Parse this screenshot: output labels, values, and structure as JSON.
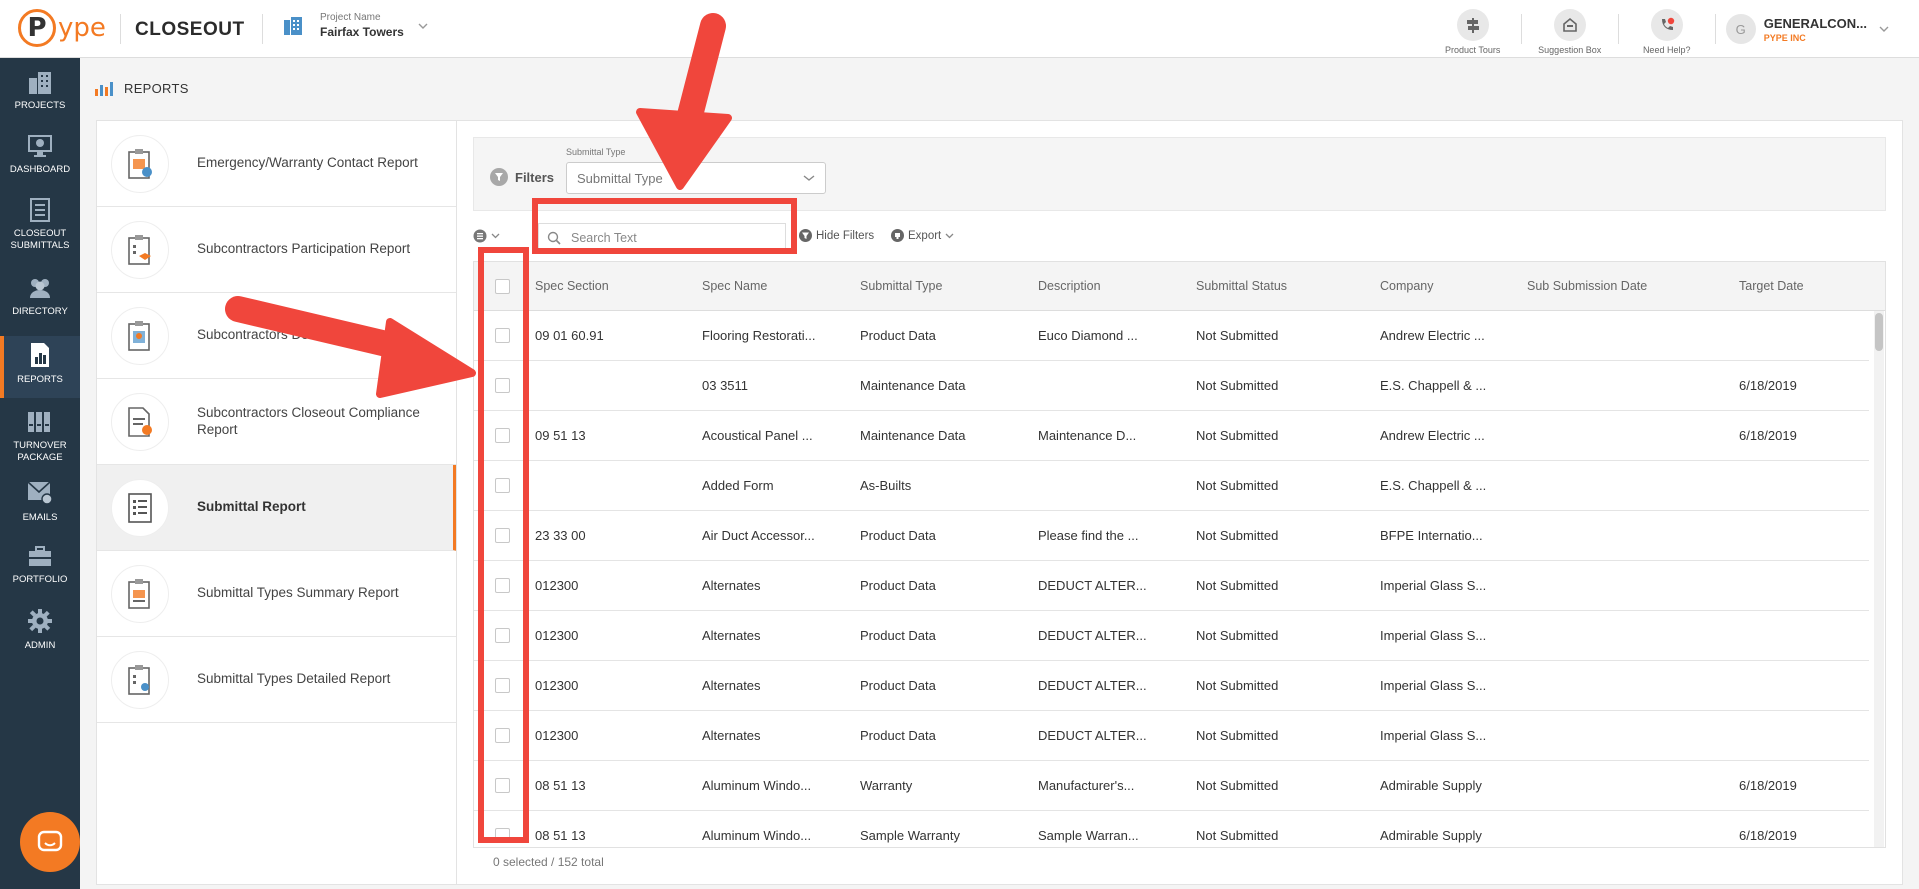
{
  "app": {
    "logo_text": "ype",
    "logo_letter": "P",
    "title": "CLOSEOUT"
  },
  "project": {
    "label": "Project Name",
    "name": "Fairfax Towers"
  },
  "top_actions": [
    {
      "label": "Product Tours",
      "icon": "signpost-icon"
    },
    {
      "label": "Suggestion Box",
      "icon": "suggestion-box-icon"
    },
    {
      "label": "Need Help?",
      "icon": "help-phone-icon"
    }
  ],
  "user": {
    "initial": "G",
    "name": "GENERALCON...",
    "company": "PYPE INC"
  },
  "nav": [
    {
      "label": "PROJECTS",
      "icon": "buildings-icon"
    },
    {
      "label": "DASHBOARD",
      "icon": "monitor-icon"
    },
    {
      "label": "CLOSEOUT SUBMITTALS",
      "icon": "document-list-icon"
    },
    {
      "label": "DIRECTORY",
      "icon": "people-icon"
    },
    {
      "label": "REPORTS",
      "icon": "report-chart-icon"
    },
    {
      "label": "TURNOVER PACKAGE",
      "icon": "binders-icon"
    },
    {
      "label": "EMAILS",
      "icon": "mail-gear-icon"
    },
    {
      "label": "PORTFOLIO",
      "icon": "briefcase-icon"
    },
    {
      "label": "ADMIN",
      "icon": "gear-icon"
    }
  ],
  "page": {
    "title": "REPORTS"
  },
  "reports": [
    "Emergency/Warranty Contact Report",
    "Subcontractors Participation Report",
    "Subcontractors Document Report",
    "Subcontractors Closeout Compliance Report",
    "Submittal Report",
    "Submittal Types Summary Report",
    "Submittal Types Detailed Report"
  ],
  "filters": {
    "label": "Filters",
    "submittal_type_label": "Submittal Type",
    "submittal_type_value": "Submittal Type"
  },
  "toolbar": {
    "search_placeholder": "Search Text",
    "hide_filters": "Hide Filters",
    "export": "Export"
  },
  "columns": [
    "Spec Section",
    "Spec Name",
    "Submittal Type",
    "Description",
    "Submittal Status",
    "Company",
    "Sub Submission Date",
    "Target Date"
  ],
  "rows": [
    [
      "09 01 60.91",
      "Flooring Restorati...",
      "Product Data",
      "Euco Diamond ...",
      "Not Submitted",
      "Andrew Electric ...",
      "",
      ""
    ],
    [
      "",
      "03 3511",
      "Maintenance Data",
      "",
      "Not Submitted",
      "E.S. Chappell & ...",
      "",
      "6/18/2019"
    ],
    [
      "09 51 13",
      "Acoustical Panel ...",
      "Maintenance Data",
      "Maintenance D...",
      "Not Submitted",
      "Andrew Electric ...",
      "",
      "6/18/2019"
    ],
    [
      "",
      "Added Form",
      "As-Builts",
      "",
      "Not Submitted",
      "E.S. Chappell & ...",
      "",
      ""
    ],
    [
      "23 33 00",
      "Air Duct Accessor...",
      "Product Data",
      "Please find the ...",
      "Not Submitted",
      "BFPE Internatio...",
      "",
      ""
    ],
    [
      "012300",
      "Alternates",
      "Product Data",
      "DEDUCT ALTER...",
      "Not Submitted",
      "Imperial Glass S...",
      "",
      ""
    ],
    [
      "012300",
      "Alternates",
      "Product Data",
      "DEDUCT ALTER...",
      "Not Submitted",
      "Imperial Glass S...",
      "",
      ""
    ],
    [
      "012300",
      "Alternates",
      "Product Data",
      "DEDUCT ALTER...",
      "Not Submitted",
      "Imperial Glass S...",
      "",
      ""
    ],
    [
      "012300",
      "Alternates",
      "Product Data",
      "DEDUCT ALTER...",
      "Not Submitted",
      "Imperial Glass S...",
      "",
      ""
    ],
    [
      "08 51 13",
      "Aluminum Windo...",
      "Warranty",
      "Manufacturer's...",
      "Not Submitted",
      "Admirable Supply",
      "",
      "6/18/2019"
    ],
    [
      "08 51 13",
      "Aluminum Windo...",
      "Sample Warranty",
      "Sample Warran...",
      "Not Submitted",
      "Admirable Supply",
      "",
      "6/18/2019"
    ]
  ],
  "footer": {
    "count": "0 selected / 152 total"
  },
  "colors": {
    "accent": "#f37a23",
    "nav_bg": "#253746",
    "annotation": "#f0463c"
  }
}
